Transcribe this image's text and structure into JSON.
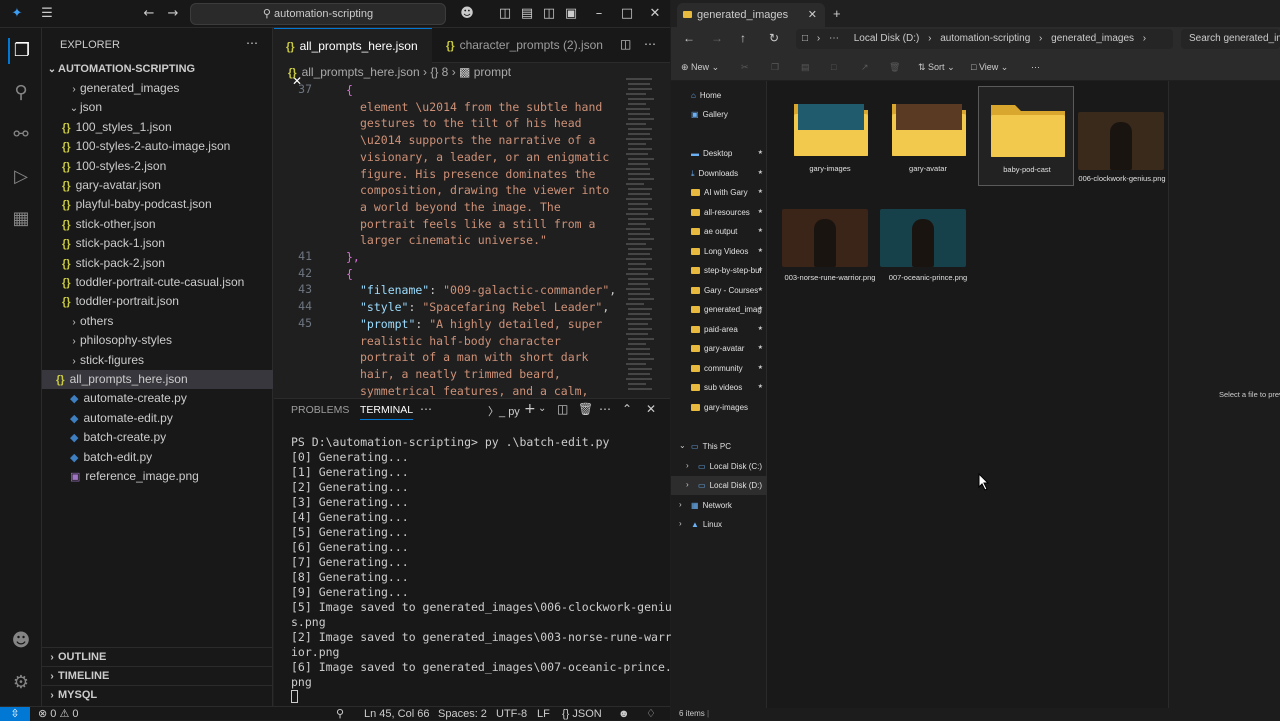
{
  "vscode": {
    "title_search": "automation-scripting",
    "explorer_header": "EXPLORER",
    "workspace": "AUTOMATION-SCRIPTING",
    "tree": [
      {
        "label": "generated_images",
        "kind": "folder",
        "depth": 1,
        "expanded": false
      },
      {
        "label": "json",
        "kind": "folder",
        "depth": 1,
        "expanded": true
      },
      {
        "label": "100_styles_1.json",
        "kind": "json",
        "depth": 2
      },
      {
        "label": "100-styles-2-auto-image.json",
        "kind": "json",
        "depth": 2
      },
      {
        "label": "100-styles-2.json",
        "kind": "json",
        "depth": 2
      },
      {
        "label": "gary-avatar.json",
        "kind": "json",
        "depth": 2
      },
      {
        "label": "playful-baby-podcast.json",
        "kind": "json",
        "depth": 2
      },
      {
        "label": "stick-other.json",
        "kind": "json",
        "depth": 2
      },
      {
        "label": "stick-pack-1.json",
        "kind": "json",
        "depth": 2
      },
      {
        "label": "stick-pack-2.json",
        "kind": "json",
        "depth": 2
      },
      {
        "label": "toddler-portrait-cute-casual.json",
        "kind": "json",
        "depth": 2
      },
      {
        "label": "toddler-portrait.json",
        "kind": "json",
        "depth": 2
      },
      {
        "label": "others",
        "kind": "folder",
        "depth": 1,
        "expanded": false
      },
      {
        "label": "philosophy-styles",
        "kind": "folder",
        "depth": 1,
        "expanded": false
      },
      {
        "label": "stick-figures",
        "kind": "folder",
        "depth": 1,
        "expanded": false
      },
      {
        "label": "all_prompts_here.json",
        "kind": "json",
        "depth": 1,
        "selected": true
      },
      {
        "label": "automate-create.py",
        "kind": "py",
        "depth": 0
      },
      {
        "label": "automate-edit.py",
        "kind": "py",
        "depth": 0
      },
      {
        "label": "batch-create.py",
        "kind": "py",
        "depth": 0
      },
      {
        "label": "batch-edit.py",
        "kind": "py",
        "depth": 0
      },
      {
        "label": "reference_image.png",
        "kind": "img",
        "depth": 0
      }
    ],
    "outline": "OUTLINE",
    "timeline": "TIMELINE",
    "mysql": "MYSQL",
    "tabs": [
      "all_prompts_here.json",
      "character_prompts (2).json"
    ],
    "breadcrumb": {
      "file": "all_prompts_here.json",
      "node": "{} 8",
      "leaf": "prompt"
    },
    "code_lines": [
      {
        "n": "37",
        "text": "{",
        "cls": "brace",
        "indent": 4
      },
      {
        "n": "",
        "text": "element \\u2014 from the subtle hand",
        "cls": "str",
        "indent": 2
      },
      {
        "n": "",
        "text": "gestures to the tilt of his head",
        "cls": "str",
        "indent": 2
      },
      {
        "n": "",
        "text": "\\u2014 supports the narrative of a",
        "cls": "str",
        "indent": 2
      },
      {
        "n": "",
        "text": "visionary, a leader, or an enigmatic",
        "cls": "str",
        "indent": 2
      },
      {
        "n": "",
        "text": "figure. His presence dominates the",
        "cls": "str",
        "indent": 2
      },
      {
        "n": "",
        "text": "composition, drawing the viewer into",
        "cls": "str",
        "indent": 2
      },
      {
        "n": "",
        "text": "a world beyond the image. The",
        "cls": "str",
        "indent": 2
      },
      {
        "n": "",
        "text": "portrait feels like a still from a",
        "cls": "str",
        "indent": 2
      },
      {
        "n": "",
        "text": "larger cinematic universe.\"",
        "cls": "str",
        "indent": 2
      },
      {
        "n": "41",
        "text": "},",
        "cls": "brace",
        "indent": 1
      },
      {
        "n": "42",
        "text": "{",
        "cls": "brace",
        "indent": 1
      },
      {
        "n": "43",
        "text": "\"filename\": \"009-galactic-commander\",",
        "cls": "kv",
        "indent": 2,
        "k": "\"filename\"",
        "v": "\"009-galactic-commander\""
      },
      {
        "n": "44",
        "text": "\"style\": \"Spacefaring Rebel Leader\",",
        "cls": "kv",
        "indent": 2,
        "k": "\"style\"",
        "v": "\"Spacefaring Rebel Leader\""
      },
      {
        "n": "45",
        "text": "\"prompt\": \"A highly detailed, super",
        "cls": "kv",
        "indent": 2,
        "k": "\"prompt\"",
        "v": "\"A highly detailed, super"
      },
      {
        "n": "",
        "text": "realistic half-body character",
        "cls": "str",
        "indent": 2
      },
      {
        "n": "",
        "text": "portrait of a man with short dark",
        "cls": "str",
        "indent": 2
      },
      {
        "n": "",
        "text": "hair, a neatly trimmed beard,",
        "cls": "str",
        "indent": 2
      },
      {
        "n": "",
        "text": "symmetrical features, and a calm,",
        "cls": "str",
        "indent": 2
      }
    ],
    "panel_tabs": [
      "PROBLEMS",
      "TERMINAL"
    ],
    "terminal_shell": "py",
    "terminal_lines": [
      "PS D:\\automation-scripting> py .\\batch-edit.py",
      "[0] Generating...",
      "[1] Generating...",
      "[2] Generating...",
      "[3] Generating...",
      "[4] Generating...",
      "[5] Generating...",
      "[6] Generating...",
      "[7] Generating...",
      "[8] Generating...",
      "[9] Generating...",
      "[5] Image saved to generated_images\\006-clockwork-geniu",
      "s.png",
      "[2] Image saved to generated_images\\003-norse-rune-warr",
      "ior.png",
      "[6] Image saved to generated_images\\007-oceanic-prince.",
      "png"
    ],
    "status": {
      "errors": "0",
      "warnings": "0",
      "position": "Ln 45, Col 66",
      "spaces": "Spaces: 2",
      "encoding": "UTF-8",
      "eol": "LF",
      "language": "{} JSON"
    }
  },
  "explorer": {
    "tab_title": "generated_images",
    "address": [
      "Local Disk (D:)",
      "automation-scripting",
      "generated_images"
    ],
    "search_placeholder": "Search generated_images",
    "cmd": {
      "new": "New",
      "sort": "Sort",
      "view": "View"
    },
    "nav_top": [
      "Home",
      "Gallery"
    ],
    "nav_pinned": [
      "Desktop",
      "Downloads",
      "AI with Gary",
      "all-resources",
      "ae output",
      "Long Videos",
      "step-by-step-bui",
      "Gary - Courses",
      "generated_imag",
      "paid-area",
      "gary-avatar",
      "community",
      "sub videos",
      "gary-images"
    ],
    "nav_tree": [
      {
        "label": "This PC",
        "depth": 0
      },
      {
        "label": "Local Disk (C:)",
        "depth": 1
      },
      {
        "label": "Local Disk (D:)",
        "depth": 1,
        "selected": true
      },
      {
        "label": "Network",
        "depth": 0
      },
      {
        "label": "Linux",
        "depth": 0
      }
    ],
    "items": [
      {
        "label": "gary-images",
        "type": "folder"
      },
      {
        "label": "gary-avatar",
        "type": "folder"
      },
      {
        "label": "baby-pod-cast",
        "type": "folder",
        "selected": true
      },
      {
        "label": "006-clockwork-genius.png",
        "type": "image",
        "tone": "#3a2a1c"
      },
      {
        "label": "003-norse-rune-warrior.png",
        "type": "image",
        "tone": "#3b2418"
      },
      {
        "label": "007-oceanic-prince.png",
        "type": "image",
        "tone": "#17414a"
      }
    ],
    "preview_text": "Select a file to prev",
    "status": "6 items"
  }
}
